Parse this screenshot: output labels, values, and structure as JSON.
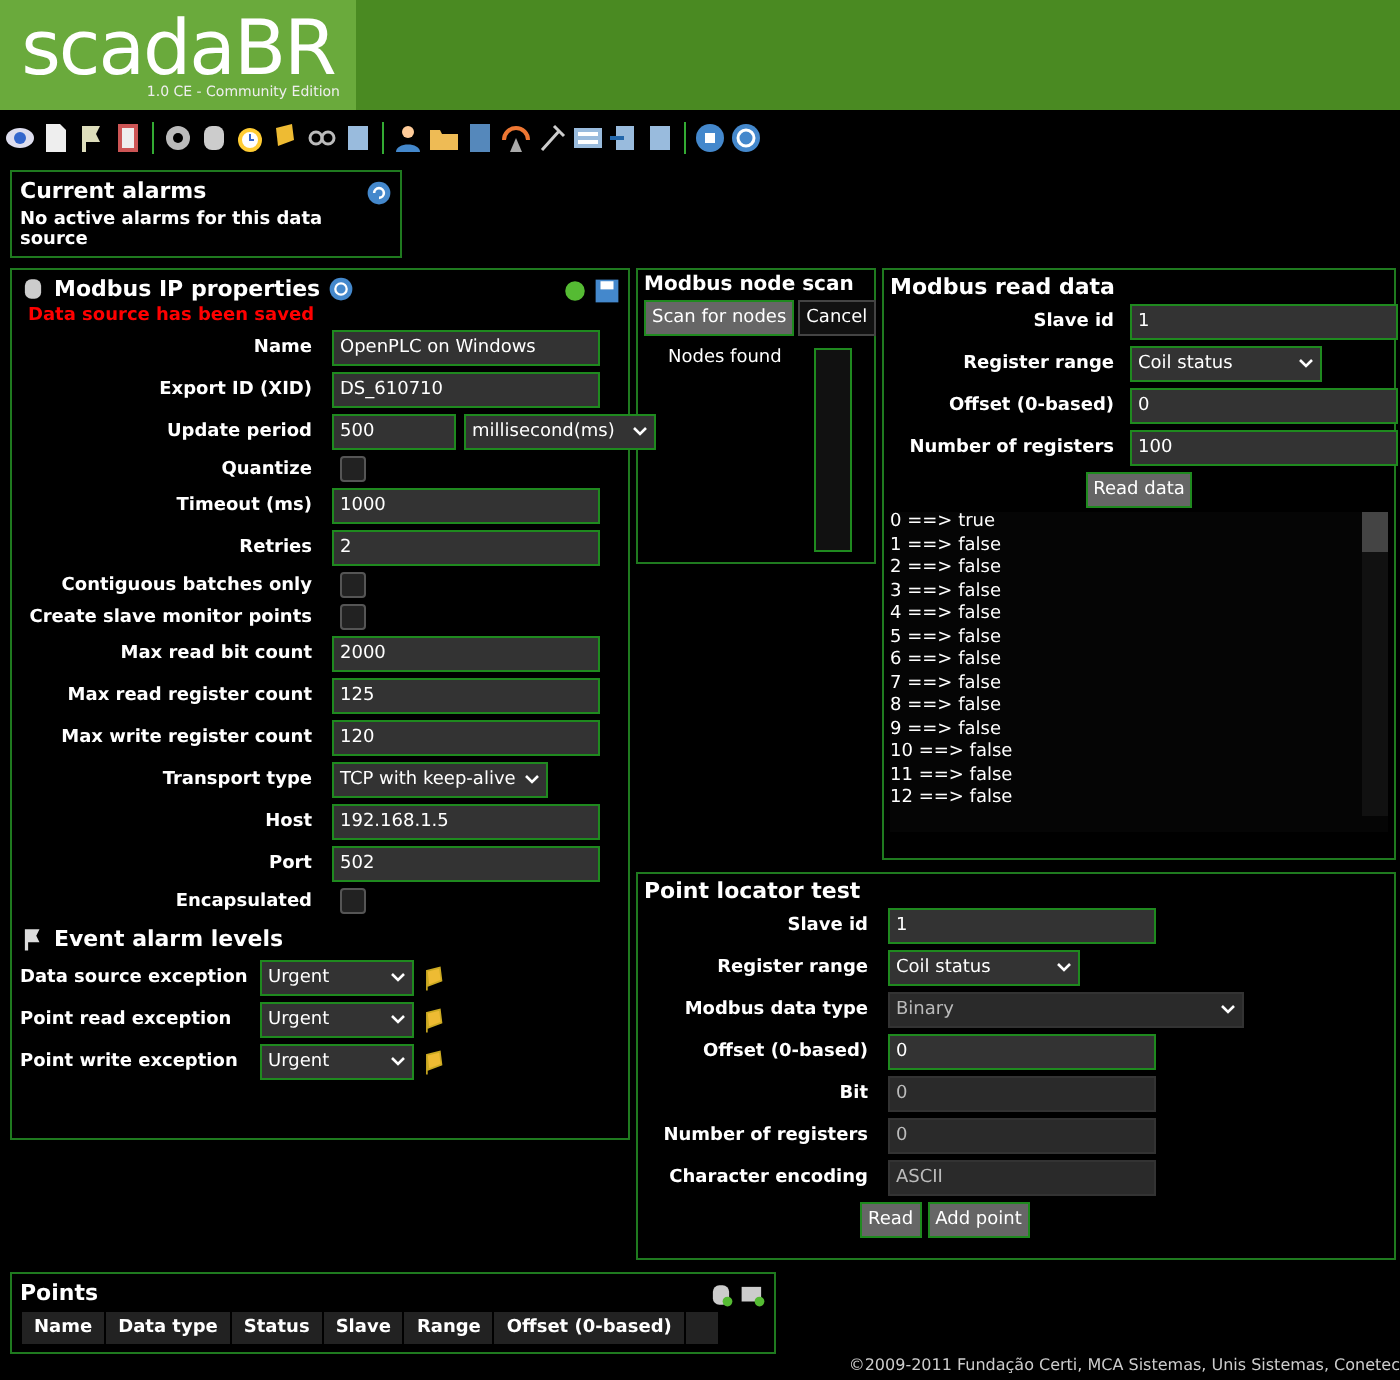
{
  "header": {
    "logo": "scadaBR",
    "edition": "1.0 CE - Community Edition"
  },
  "alarms": {
    "title": "Current alarms",
    "message": "No active alarms for this data source"
  },
  "properties": {
    "title": "Modbus IP properties",
    "status": "Data source has been saved",
    "fields": [
      {
        "kind": "text",
        "label": "Name",
        "value": "OpenPLC on Windows"
      },
      {
        "kind": "text",
        "label": "Export ID (XID)",
        "value": "DS_610710"
      },
      {
        "kind": "period",
        "label": "Update period",
        "value": "500",
        "unit": "millisecond(ms)"
      },
      {
        "kind": "checkbox",
        "label": "Quantize",
        "checked": false
      },
      {
        "kind": "text",
        "label": "Timeout (ms)",
        "value": "1000"
      },
      {
        "kind": "text",
        "label": "Retries",
        "value": "2"
      },
      {
        "kind": "checkbox",
        "label": "Contiguous batches only",
        "checked": false
      },
      {
        "kind": "checkbox",
        "label": "Create slave monitor points",
        "checked": false
      },
      {
        "kind": "text",
        "label": "Max read bit count",
        "value": "2000"
      },
      {
        "kind": "text",
        "label": "Max read register count",
        "value": "125"
      },
      {
        "kind": "text",
        "label": "Max write register count",
        "value": "120"
      },
      {
        "kind": "select",
        "label": "Transport type",
        "value": "TCP with keep-alive"
      },
      {
        "kind": "text",
        "label": "Host",
        "value": "192.168.1.5"
      },
      {
        "kind": "text",
        "label": "Port",
        "value": "502"
      },
      {
        "kind": "checkbox",
        "label": "Encapsulated",
        "checked": false
      }
    ],
    "event_title": "Event alarm levels",
    "events": [
      {
        "label": "Data source exception",
        "value": "Urgent"
      },
      {
        "label": "Point read exception",
        "value": "Urgent"
      },
      {
        "label": "Point write exception",
        "value": "Urgent"
      }
    ]
  },
  "node_scan": {
    "title": "Modbus node scan",
    "buttons": [
      "Scan for nodes",
      "Cancel"
    ],
    "nodes_label": "Nodes found"
  },
  "read_data": {
    "title": "Modbus read data",
    "fields": [
      {
        "kind": "text",
        "label": "Slave id",
        "value": "1"
      },
      {
        "kind": "select",
        "label": "Register range",
        "value": "Coil status"
      },
      {
        "kind": "text",
        "label": "Offset (0-based)",
        "value": "0"
      },
      {
        "kind": "text",
        "label": "Number of registers",
        "value": "100"
      }
    ],
    "button": "Read data",
    "results": [
      "0 ==> true",
      "1 ==> false",
      "2 ==> false",
      "3 ==> false",
      "4 ==> false",
      "5 ==> false",
      "6 ==> false",
      "7 ==> false",
      "8 ==> false",
      "9 ==> false",
      "10 ==> false",
      "11 ==> false",
      "12 ==> false"
    ]
  },
  "locator": {
    "title": "Point locator test",
    "fields": [
      {
        "kind": "text",
        "label": "Slave id",
        "value": "1",
        "disabled": false
      },
      {
        "kind": "select",
        "label": "Register range",
        "value": "Coil status",
        "disabled": false
      },
      {
        "kind": "wideselect",
        "label": "Modbus data type",
        "value": "Binary",
        "disabled": true
      },
      {
        "kind": "text",
        "label": "Offset (0-based)",
        "value": "0",
        "disabled": false
      },
      {
        "kind": "text",
        "label": "Bit",
        "value": "0",
        "disabled": true
      },
      {
        "kind": "text",
        "label": "Number of registers",
        "value": "0",
        "disabled": true
      },
      {
        "kind": "text",
        "label": "Character encoding",
        "value": "ASCII",
        "disabled": true
      }
    ],
    "buttons": [
      "Read",
      "Add point"
    ]
  },
  "points": {
    "title": "Points",
    "columns": [
      "Name",
      "Data type",
      "Status",
      "Slave",
      "Range",
      "Offset (0-based)"
    ]
  },
  "footer": "©2009-2011 Fundação Certi, MCA Sistemas, Unis Sistemas, Conetec"
}
